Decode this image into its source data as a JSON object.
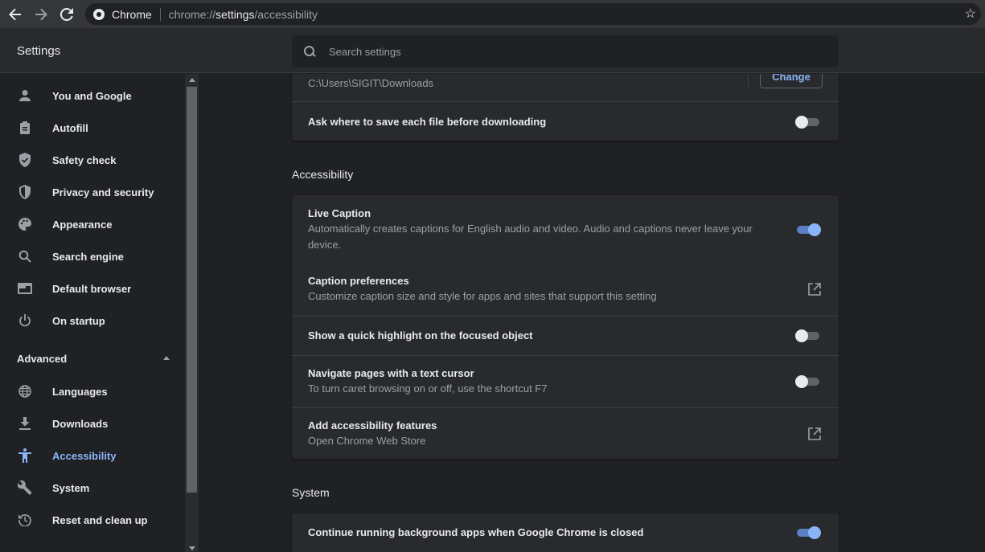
{
  "browser": {
    "chip": "Chrome",
    "url_scheme": "chrome://",
    "url_host": "settings",
    "url_path": "/accessibility"
  },
  "header": {
    "title": "Settings",
    "search_placeholder": "Search settings"
  },
  "sidebar": {
    "items": [
      {
        "label": "You and Google",
        "icon": "person-icon"
      },
      {
        "label": "Autofill",
        "icon": "clipboard-icon"
      },
      {
        "label": "Safety check",
        "icon": "shield-check-icon"
      },
      {
        "label": "Privacy and security",
        "icon": "shield-icon"
      },
      {
        "label": "Appearance",
        "icon": "palette-icon"
      },
      {
        "label": "Search engine",
        "icon": "search-icon"
      },
      {
        "label": "Default browser",
        "icon": "browser-window-icon"
      },
      {
        "label": "On startup",
        "icon": "power-icon"
      }
    ],
    "advanced_label": "Advanced",
    "advanced_items": [
      {
        "label": "Languages",
        "icon": "globe-icon"
      },
      {
        "label": "Downloads",
        "icon": "download-icon"
      },
      {
        "label": "Accessibility",
        "icon": "accessibility-icon",
        "active": true
      },
      {
        "label": "System",
        "icon": "wrench-icon"
      },
      {
        "label": "Reset and clean up",
        "icon": "history-icon"
      }
    ]
  },
  "downloads": {
    "location_path": "C:\\Users\\SIGIT\\Downloads",
    "change_label": "Change",
    "ask_where_label": "Ask where to save each file before downloading",
    "ask_where_on": false
  },
  "accessibility": {
    "section_title": "Accessibility",
    "live_caption_title": "Live Caption",
    "live_caption_sub": "Automatically creates captions for English audio and video. Audio and captions never leave your device.",
    "live_caption_on": true,
    "caption_prefs_title": "Caption preferences",
    "caption_prefs_sub": "Customize caption size and style for apps and sites that support this setting",
    "highlight_title": "Show a quick highlight on the focused object",
    "highlight_on": false,
    "caret_title": "Navigate pages with a text cursor",
    "caret_sub": "To turn caret browsing on or off, use the shortcut F7",
    "caret_on": false,
    "add_features_title": "Add accessibility features",
    "add_features_sub": "Open Chrome Web Store"
  },
  "system": {
    "section_title": "System",
    "background_apps_title": "Continue running background apps when Google Chrome is closed",
    "background_apps_on": true
  },
  "colors": {
    "accent": "#8ab4f8",
    "background": "#202124",
    "card": "#292a2d"
  }
}
